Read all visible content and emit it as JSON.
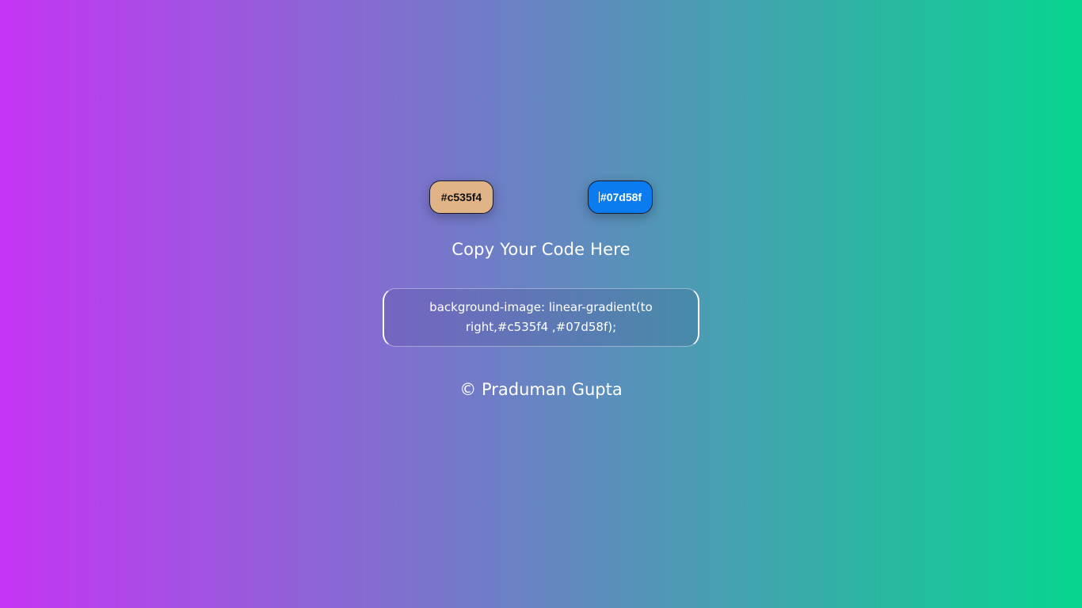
{
  "colors": {
    "color_one": "#c535f4",
    "color_two": "#07d58f",
    "color_one_button_bg": "#e0b486",
    "color_two_button_bg": "#0a7cf0"
  },
  "picker_one": {
    "label": "#c535f4"
  },
  "picker_two": {
    "label": "#07d58f"
  },
  "heading": "Copy Your Code Here",
  "code_output": "background-image: linear-gradient(to right,#c535f4 ,#07d58f);",
  "footer": "© Praduman Gupta"
}
